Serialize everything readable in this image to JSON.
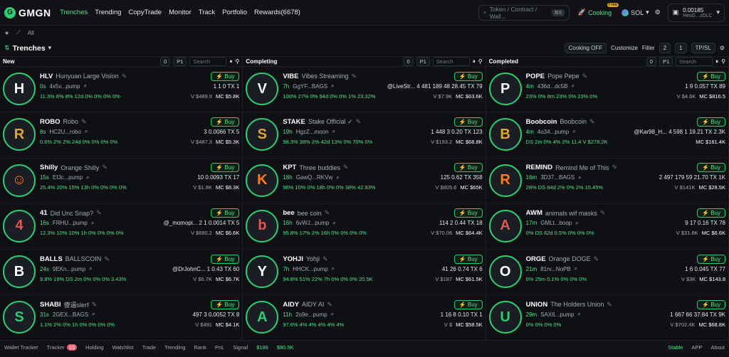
{
  "app": {
    "logo": "GMGN",
    "nav": [
      "Trenches",
      "Trending",
      "CopyTrade",
      "Monitor",
      "Track",
      "Portfolio",
      "Rewards(6678)"
    ],
    "search_placeholder": "Token / Contract / Wall...",
    "kbd": "⌘K",
    "cooking": "Cooking",
    "free": "Free",
    "chain": "SOL",
    "balance": "0.00185",
    "address": "HesG...zDLC"
  },
  "subbar": {
    "all": "All"
  },
  "title": "Trenches",
  "toolbar": {
    "cooking_off": "Cooking OFF",
    "customize": "Customize",
    "filter": "Filter",
    "filter_count": "2",
    "page": "1",
    "tpsl": "TP/SL"
  },
  "columns": [
    {
      "name": "New",
      "amount": "0",
      "preset": "P1",
      "search": "Search",
      "cards": [
        {
          "sym": "HLV",
          "name": "Hunyuan Large Vision",
          "avatar": "H",
          "age": "0s",
          "contract": "4x5v...pump",
          "stats": "1  1  0  TX 1",
          "pct": "11.3%  8%  8% 12d  0%  0%  0%  0%",
          "v": "V $489.9",
          "mc": "MC $5.8K"
        },
        {
          "sym": "ROBO",
          "name": "Robo",
          "avatar": "R",
          "age": "8s",
          "contract": "HC2U...robo",
          "stats": "3  0.0066  TX 5",
          "pct": "0.6%  2%  2% 24d  0%  0%  0%  0%",
          "v": "V $487.3",
          "mc": "MC $5.3K"
        },
        {
          "sym": "Shilly",
          "name": "Orange Shilly",
          "avatar": "☺",
          "age": "15s",
          "contract": "EfJc...pump",
          "stats": "10  0.0093  TX 17",
          "pct": "25.4%  20%  15%  13h  0%  0%  0%  0%",
          "v": "V $1.8K",
          "mc": "MC $8.3K"
        },
        {
          "sym": "41",
          "name": "Did Unc Snap?",
          "avatar": "4",
          "age": "16s",
          "contract": "FRHU...pump",
          "stats": "@_momopi...  2  1  0.0014  TX 5",
          "pct": "12.3%  10%  10% 1h  0%  0%  0%  0%",
          "v": "V $690.2",
          "mc": "MC $6.6K"
        },
        {
          "sym": "BALLS",
          "name": "BALLSCOIN",
          "avatar": "B",
          "age": "24s",
          "contract": "9EKn...pump",
          "stats": "@DrJohnC...  1  0.43  TX 60",
          "pct": "9.8%  19%  DS 2m  0%  0%  0%  3.43%",
          "v": "V $6.7K",
          "mc": "MC $6.7K"
        },
        {
          "sym": "SHABI",
          "name": "傻逼slerf",
          "avatar": "S",
          "age": "31s",
          "contract": "2GEX...BAGS",
          "stats": "497  3  0.0052  TX 8",
          "pct": "1.1%  2%  0%  1h  0%  0%  0%  0%",
          "v": "V $491",
          "mc": "MC $4.1K"
        }
      ]
    },
    {
      "name": "Completing",
      "amount": "0",
      "preset": "P1",
      "search": "Search",
      "cards": [
        {
          "sym": "VIBE",
          "name": "Vibes Streaming",
          "avatar": "V",
          "age": "7h",
          "contract": "GgYF...BAGS",
          "stats": "@LiveStr...  4  481  189  48  28.45  TX 79",
          "pct": "100%  27%  0% 94d  0%  0%  1%  23.32%",
          "v": "V $7.9K",
          "mc": "MC $63.6K"
        },
        {
          "sym": "STAKE",
          "name": "Stake Official ✓",
          "avatar": "S",
          "age": "19h",
          "contract": "HgzZ...moon",
          "stats": "1  448  3  0.20  TX 123",
          "pct": "98.3%  38%  2% 42d  13%  0%  70%  0%",
          "v": "V $193.2",
          "mc": "MC $68.8K"
        },
        {
          "sym": "KPT",
          "name": "Three buddies",
          "avatar": "K",
          "age": "18h",
          "contract": "GawQ...RKVw",
          "stats": "125  0.62  TX 358",
          "pct": "96%  10%  0% 18h  0%  0%  38%  42.93%",
          "v": "V $605.6",
          "mc": "MC $65K"
        },
        {
          "sym": "bee",
          "name": "bee coin",
          "avatar": "b",
          "age": "16h",
          "contract": "6vWJ...pump",
          "stats": "114  2  0.44  TX 18",
          "pct": "95.8%  17%  2% 16h  0%  0%  0%  0%",
          "v": "V $70.06",
          "mc": "MC $64.4K"
        },
        {
          "sym": "YOHJI",
          "name": "Yohji",
          "avatar": "Y",
          "age": "7h",
          "contract": "HHCK...pump",
          "stats": "41  26  0.74  TX 6",
          "pct": "94.8%  51%  22%  7h  0%  0%  0%  20.5K",
          "v": "V $187",
          "mc": "MC $61.5K"
        },
        {
          "sym": "AIDY",
          "name": "AIDY AI",
          "avatar": "A",
          "age": "11h",
          "contract": "2o9e...pump",
          "stats": "1  16  8  0.10  TX 1",
          "pct": "97.6%  4%  4%  4%  4%  4%",
          "v": "V $",
          "mc": "MC $58.5K"
        }
      ]
    },
    {
      "name": "Completed",
      "amount": "0",
      "preset": "P1",
      "search": "Search",
      "cards": [
        {
          "sym": "POPE",
          "name": "Pope Pepe",
          "avatar": "P",
          "age": "4m",
          "contract": "436d...dc5B",
          "stats": "1  9  0.057  TX 89",
          "pct": "23%  0% 8m  23%  0%  23%  0%",
          "v": "V $4.6K",
          "mc": "MC $816.5"
        },
        {
          "sym": "Boobcoin",
          "name": "Boobcoin",
          "avatar": "B",
          "age": "4m",
          "contract": "4o34...pump",
          "stats": "@Kar98_H...  4  598  1  19.21  TX 2.3K",
          "pct": "DS 2m  0%  4%  2%  11.4  V $278.2K",
          "v": "",
          "mc": "MC $181.4K"
        },
        {
          "sym": "REMIND",
          "name": "Remind Me of This",
          "avatar": "R",
          "age": "16m",
          "contract": "3D37...BAGS",
          "stats": "2  497  179  59  21.70  TX 1K",
          "pct": "28%  DS 84d  2%  0%  2%  15.45%",
          "v": "V $141K",
          "mc": "MC $28.5K"
        },
        {
          "sym": "AWM",
          "name": "animals wif masks",
          "avatar": "A",
          "age": "17m",
          "contract": "GMLt...boop",
          "stats": "9  17  0.16  TX 78",
          "pct": "0%  DS 62d  0.5%  0%  0%  0%",
          "v": "V $31.6K",
          "mc": "MC $6.6K"
        },
        {
          "sym": "ORGE",
          "name": "Orange DOGE",
          "avatar": "O",
          "age": "21m",
          "contract": "81rv...NoPB",
          "stats": "1  6  0.045  TX 77",
          "pct": "0%  25m  0.1%  0%  0%  0%",
          "v": "V $3K",
          "mc": "MC $143.8"
        },
        {
          "sym": "UNION",
          "name": "The Holders Union",
          "avatar": "U",
          "age": "29m",
          "contract": "SAX6...pump",
          "stats": "1  667  66  37.84  TX 9K",
          "pct": "0%  0%  0%  0%",
          "v": "V $702.4K",
          "mc": "MC $68.8K"
        }
      ]
    }
  ],
  "bottom": {
    "items": [
      "Wallet Tracker",
      "Tracker",
      "Holding",
      "Watchlist",
      "Trade",
      "Trending",
      "Rank",
      "PnL",
      "Signal"
    ],
    "tracker_badge": "15",
    "price1": "$186",
    "price2": "$80.5K",
    "stable": "Stable",
    "app": "APP",
    "about": "About"
  }
}
